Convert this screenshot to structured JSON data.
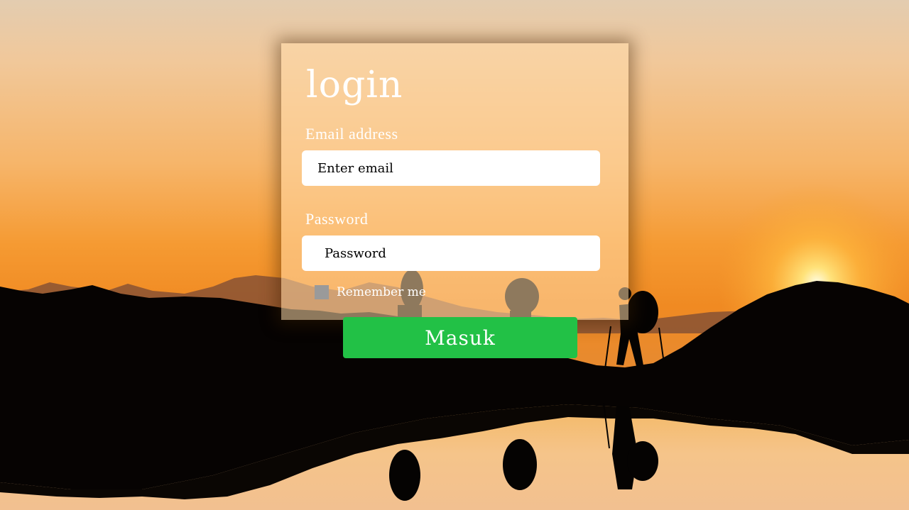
{
  "form": {
    "title": "login",
    "email_label": "Email address",
    "email_placeholder": "Enter email",
    "password_label": "Password",
    "password_placeholder": "Password",
    "remember_label": "Remember me",
    "submit_label": "Masuk"
  },
  "colors": {
    "submit_button": "#22c146",
    "checkbox": "#9a9a9a",
    "text": "#ffffff"
  }
}
